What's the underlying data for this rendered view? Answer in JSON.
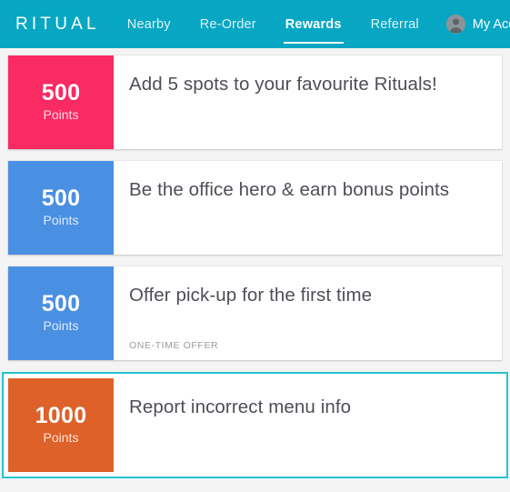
{
  "header": {
    "brand": "RITUAL",
    "nav": [
      {
        "label": "Nearby",
        "active": false
      },
      {
        "label": "Re-Order",
        "active": false
      },
      {
        "label": "Rewards",
        "active": true
      },
      {
        "label": "Referral",
        "active": false
      }
    ],
    "account_label": "My Account",
    "avatar_icon": "user-avatar-icon",
    "background_color": "#07a7c3"
  },
  "rewards": [
    {
      "points": "500",
      "points_label": "Points",
      "badge_color": "#fa2a62",
      "title": "Add 5 spots to your favourite Rituals!",
      "tag": "",
      "selected": false
    },
    {
      "points": "500",
      "points_label": "Points",
      "badge_color": "#4a90e2",
      "title": "Be the office hero & earn bonus points",
      "tag": "",
      "selected": false
    },
    {
      "points": "500",
      "points_label": "Points",
      "badge_color": "#4a90e2",
      "title": "Offer pick-up for the first time",
      "tag": "ONE-TIME OFFER",
      "selected": false
    },
    {
      "points": "1000",
      "points_label": "Points",
      "badge_color": "#dd6129",
      "title": "Report incorrect menu info",
      "tag": "",
      "selected": true
    }
  ],
  "theme": {
    "page_background": "#f4f4f4",
    "selection_border": "#27c3cf",
    "title_color": "#4e4e57",
    "tag_color": "#9b9ba3"
  }
}
